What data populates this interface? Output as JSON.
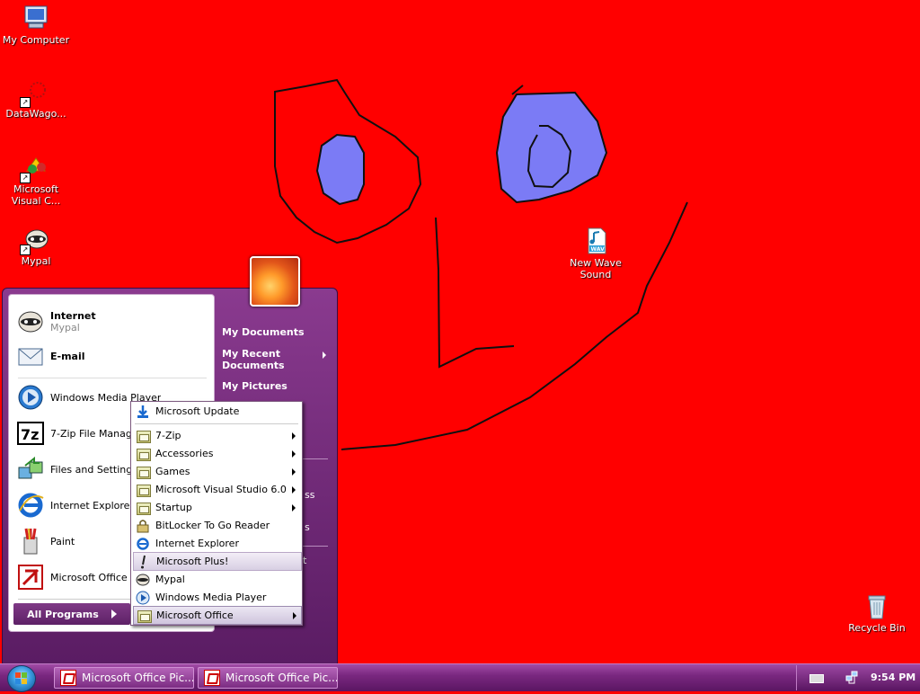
{
  "desktop": {
    "background": "#ff0000",
    "icons": [
      {
        "label": "My Computer",
        "icon": "computer-icon"
      },
      {
        "label": "DataWago...",
        "icon": "datawagon-icon"
      },
      {
        "label": "Microsoft Visual C...",
        "icon": "visual-c-icon"
      },
      {
        "label": "Mypal",
        "icon": "mypal-icon"
      },
      {
        "label": "New Wave Sound",
        "icon": "wav-file-icon"
      },
      {
        "label": "Recycle Bin",
        "icon": "recycle-bin-icon"
      }
    ],
    "wav_tag": "WAV"
  },
  "start_menu": {
    "pinned": [
      {
        "title": "Internet",
        "subtitle": "Mypal"
      },
      {
        "title": "E-mail",
        "subtitle": ""
      }
    ],
    "recent": [
      "Windows Media Player",
      "7-Zip File Manager",
      "Files and Settings Transfer Wizard",
      "Internet Explorer",
      "Paint",
      "Microsoft Office Picture Manager"
    ],
    "all_programs": "All Programs",
    "right": [
      "My Documents",
      "My Recent Documents",
      "My Pictures"
    ],
    "right_partial": [
      "ss",
      "s",
      "t"
    ]
  },
  "programs_menu": {
    "items": [
      {
        "label": "Microsoft Update",
        "submenu": false
      },
      {
        "label": "7-Zip",
        "submenu": true
      },
      {
        "label": "Accessories",
        "submenu": true
      },
      {
        "label": "Games",
        "submenu": true
      },
      {
        "label": "Microsoft Visual Studio 6.0",
        "submenu": true
      },
      {
        "label": "Startup",
        "submenu": true
      },
      {
        "label": "BitLocker To Go Reader",
        "submenu": false
      },
      {
        "label": "Internet Explorer",
        "submenu": false
      },
      {
        "label": "Microsoft Plus!",
        "submenu": false
      },
      {
        "label": "Mypal",
        "submenu": false
      },
      {
        "label": "Windows Media Player",
        "submenu": false
      },
      {
        "label": "Microsoft Office",
        "submenu": true
      }
    ]
  },
  "taskbar": {
    "buttons": [
      "Microsoft Office Pic...",
      "Microsoft Office Pic..."
    ],
    "clock": "9:54 PM"
  },
  "colors": {
    "accent": "#7a2880",
    "drawing_fill": "#7b7bf5",
    "drawing_stroke": "#101010"
  }
}
